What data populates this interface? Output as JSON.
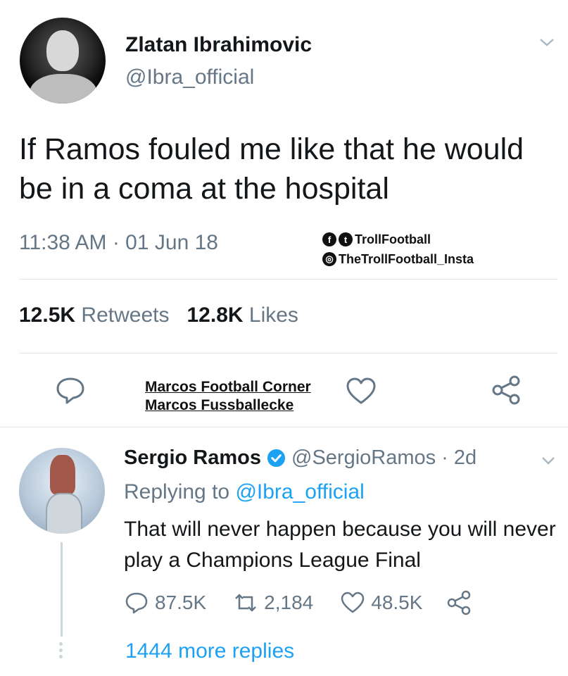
{
  "main_tweet": {
    "author_name": "Zlatan Ibrahimovic",
    "handle": "@Ibra_official",
    "text": "If Ramos fouled me like that he would be in a coma at the hospital",
    "timestamp": "11:38 AM · 01 Jun 18",
    "retweets_count": "12.5K",
    "retweets_label": "Retweets",
    "likes_count": "12.8K",
    "likes_label": "Likes"
  },
  "watermarks": {
    "troll_line1": "TrollFootball",
    "troll_line2": "TheTrollFootball_Insta",
    "marcos_line1": "Marcos Football Corner",
    "marcos_line2": "Marcos Fussballecke"
  },
  "reply_tweet": {
    "author_name": "Sergio Ramos",
    "meta": "@SergioRamos · 2d",
    "replying_prefix": "Replying to",
    "replying_mention": "@Ibra_official",
    "text": "That will never happen because you will never play a Champions League Final",
    "reply_count": "87.5K",
    "retweet_count": "2,184",
    "like_count": "48.5K"
  },
  "thread": {
    "more_replies": "1444 more replies"
  },
  "colors": {
    "text": "#14171a",
    "secondary": "#657786",
    "link": "#1da1f2",
    "divider": "#e1e8ed"
  },
  "icons": [
    "chevron-down-icon",
    "reply-icon",
    "heart-icon",
    "share-icon",
    "verified-icon",
    "retweet-icon"
  ]
}
